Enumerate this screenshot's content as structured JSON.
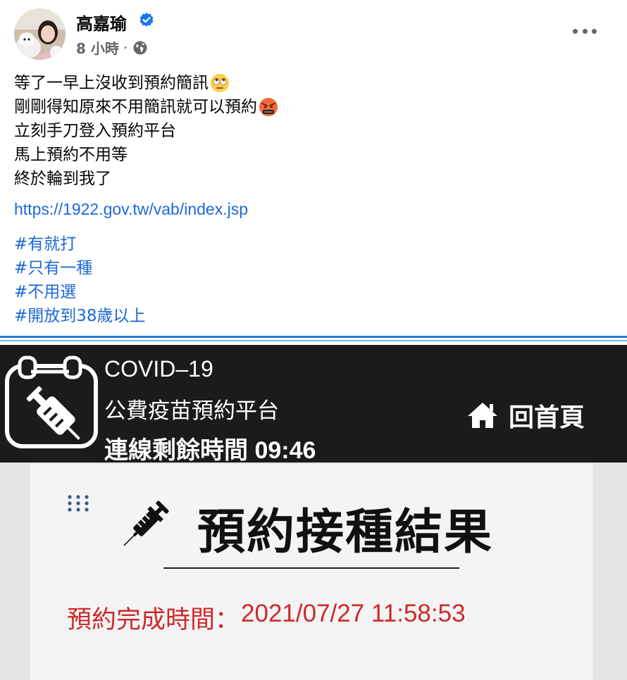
{
  "post": {
    "author": "高嘉瑜",
    "verified_icon": "verified-badge-icon",
    "time": "8 小時",
    "separator": "·",
    "audience_icon": "globe-icon",
    "more_icon": "more-options-icon",
    "lines": [
      "等了一早上沒收到預約簡訊",
      "剛剛得知原來不用簡訊就可以預約",
      "立刻手刀登入預約平台",
      "馬上預約不用等",
      "終於輪到我了"
    ],
    "emojis": [
      "eye-roll-emoji",
      "angry-emoji"
    ],
    "link": "https://1922.gov.tw/vab/index.jsp",
    "hashtags": [
      "#有就打",
      "#只有一種",
      "#不用選",
      "#開放到38歲以上"
    ]
  },
  "screenshot": {
    "logo_icon": "calendar-syringe-logo-icon",
    "banner": {
      "line1": "COVID–19",
      "line2": "公費疫苗預約平台",
      "line3": "連線剩餘時間 09:46",
      "home_icon": "home-icon",
      "home_label": "回首頁"
    },
    "menu_icon": "grid-dots-icon",
    "title_icon": "syringe-icon",
    "title": "預約接種結果",
    "completion_label": "預約完成時間：",
    "completion_value": "2021/07/27 11:58:53"
  },
  "colors": {
    "link": "#1d68d6",
    "banner_bg": "#1b1b1b",
    "completion_text": "#cc2a2a",
    "verified": "#1877f2"
  }
}
